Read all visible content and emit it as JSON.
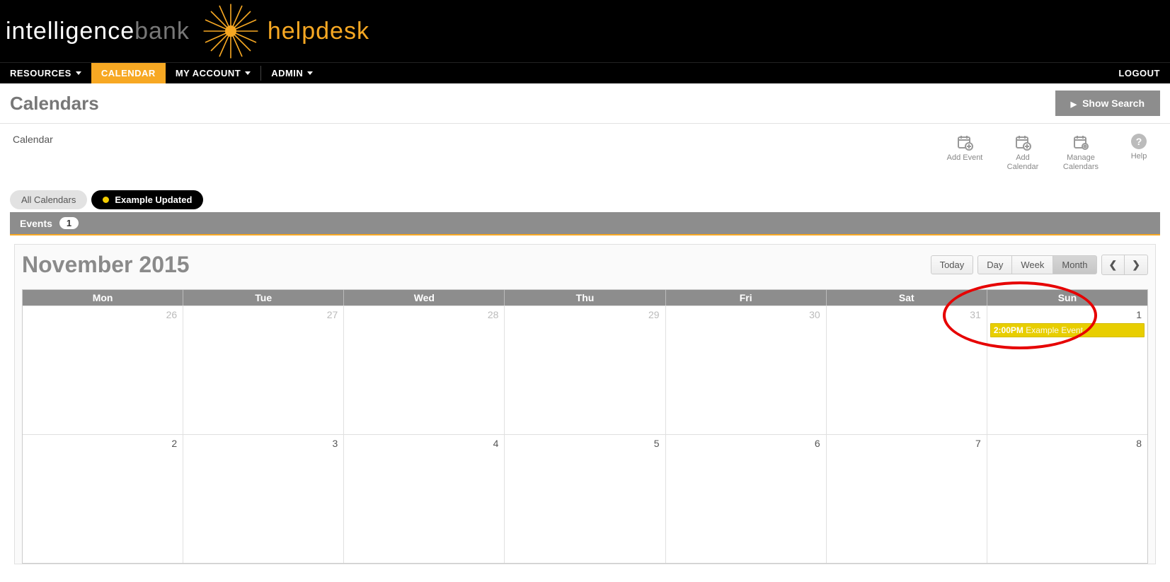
{
  "brand": {
    "part1": "intelligence",
    "part2": "bank",
    "product": "helpdesk"
  },
  "nav": {
    "items": [
      {
        "label": "RESOURCES",
        "dropdown": true,
        "active": false
      },
      {
        "label": "CALENDAR",
        "dropdown": false,
        "active": true
      },
      {
        "label": "MY ACCOUNT",
        "dropdown": true,
        "active": false
      },
      {
        "label": "ADMIN",
        "dropdown": true,
        "active": false
      }
    ],
    "logout": "LOGOUT"
  },
  "page": {
    "title": "Calendars",
    "show_search": "Show Search",
    "breadcrumb": "Calendar"
  },
  "tools": {
    "add_event": "Add Event",
    "add_calendar": "Add Calendar",
    "manage_calendars": "Manage Calendars",
    "help": "Help"
  },
  "tabs": {
    "all": "All Calendars",
    "selected": "Example Updated"
  },
  "events_bar": {
    "label": "Events",
    "count": "1"
  },
  "calendar": {
    "month_title": "November 2015",
    "today": "Today",
    "views": {
      "day": "Day",
      "week": "Week",
      "month": "Month"
    },
    "weekdays": [
      "Mon",
      "Tue",
      "Wed",
      "Thu",
      "Fri",
      "Sat",
      "Sun"
    ],
    "rows": [
      {
        "days": [
          {
            "num": "26",
            "other": true
          },
          {
            "num": "27",
            "other": true
          },
          {
            "num": "28",
            "other": true
          },
          {
            "num": "29",
            "other": true
          },
          {
            "num": "30",
            "other": true
          },
          {
            "num": "31",
            "other": true
          },
          {
            "num": "1",
            "other": false,
            "event": {
              "time": "2:00PM",
              "title": "Example Event"
            }
          }
        ]
      },
      {
        "days": [
          {
            "num": "2",
            "other": false
          },
          {
            "num": "3",
            "other": false
          },
          {
            "num": "4",
            "other": false
          },
          {
            "num": "5",
            "other": false
          },
          {
            "num": "6",
            "other": false
          },
          {
            "num": "7",
            "other": false
          },
          {
            "num": "8",
            "other": false
          }
        ]
      }
    ]
  }
}
